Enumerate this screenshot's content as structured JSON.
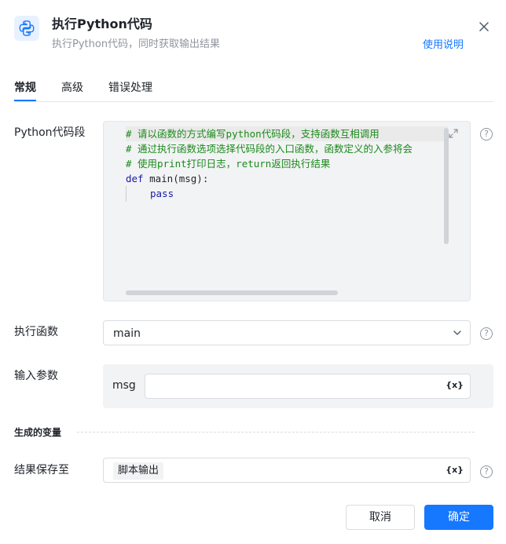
{
  "header": {
    "icon": "python-icon",
    "title": "执行Python代码",
    "subtitle": "执行Python代码，同时获取输出结果",
    "help_link": "使用说明",
    "close_icon": "close-icon"
  },
  "tabs": [
    {
      "label": "常规",
      "active": true
    },
    {
      "label": "高级",
      "active": false
    },
    {
      "label": "错误处理",
      "active": false
    }
  ],
  "code_section": {
    "label": "Python代码段",
    "lines": [
      "# 请以函数的方式编写python代码段，支持函数互相调用",
      "# 通过执行函数选项选择代码段的入口函数，函数定义的入参将会",
      "# 使用print打印日志，return返回执行结果",
      "def",
      " main(msg):",
      "pass"
    ]
  },
  "function_section": {
    "label": "执行函数",
    "selected": "main"
  },
  "params_section": {
    "label": "输入参数",
    "param_name": "msg",
    "param_value": "",
    "var_icon_text": "{x}"
  },
  "variables_section": {
    "title": "生成的变量"
  },
  "result_section": {
    "label": "结果保存至",
    "chip": "脚本输出",
    "var_icon_text": "{x}"
  },
  "help_icon_text": "?",
  "footer": {
    "cancel": "取消",
    "ok": "确定"
  },
  "colors": {
    "accent": "#1677ff",
    "comment": "#1a8a1a",
    "keyword": "#1a1aa6"
  }
}
